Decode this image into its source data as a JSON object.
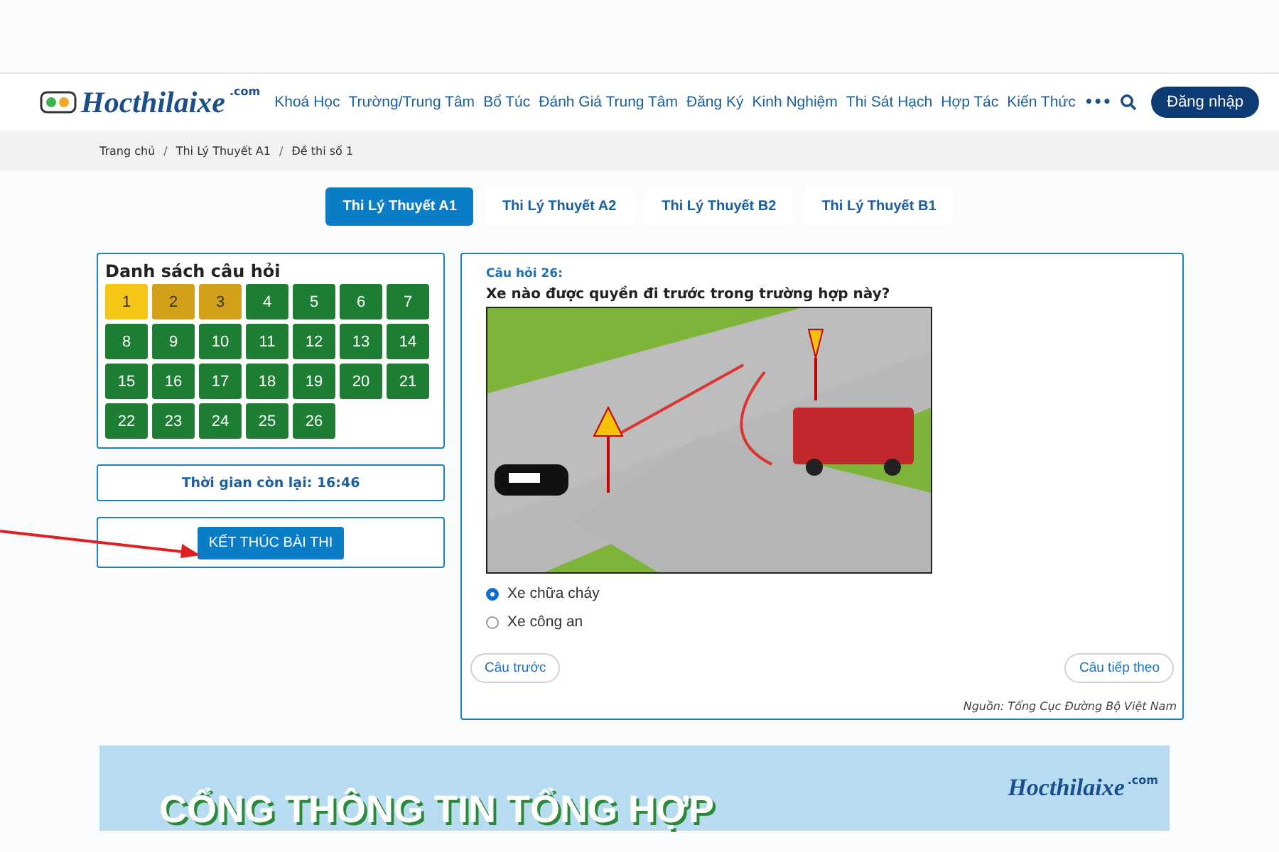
{
  "header": {
    "logo": {
      "name": "Hocthilaixe",
      "suffix": ".com"
    },
    "nav": [
      "Khoá Học",
      "Trường/Trung Tâm",
      "Bổ Túc",
      "Đánh Giá Trung Tâm",
      "Đăng Ký",
      "Kinh Nghiệm",
      "Thi Sát Hạch",
      "Hợp Tác",
      "Kiến Thức"
    ],
    "more": "•••",
    "login": "Đăng nhập"
  },
  "breadcrumb": {
    "separator": "/",
    "items": [
      "Trang chủ",
      "Thi Lý Thuyết A1",
      "Đề thi số 1"
    ]
  },
  "tabs": [
    {
      "label": "Thi Lý Thuyết A1",
      "selected": true
    },
    {
      "label": "Thi Lý Thuyết A2",
      "selected": false
    },
    {
      "label": "Thi Lý Thuyết B2",
      "selected": false
    },
    {
      "label": "Thi Lý Thuyết B1",
      "selected": false
    }
  ],
  "question_list": {
    "title": "Danh sách câu hỏi",
    "items": [
      {
        "label": "1",
        "color": "#f5c518"
      },
      {
        "label": "2",
        "color": "#d4a017"
      },
      {
        "label": "3",
        "color": "#d4a017"
      },
      {
        "label": "4",
        "color": "#1e7e34"
      },
      {
        "label": "5",
        "color": "#1e7e34"
      },
      {
        "label": "6",
        "color": "#1e7e34"
      },
      {
        "label": "7",
        "color": "#1e7e34"
      },
      {
        "label": "8",
        "color": "#1e7e34"
      },
      {
        "label": "9",
        "color": "#1e7e34"
      },
      {
        "label": "10",
        "color": "#1e7e34"
      },
      {
        "label": "11",
        "color": "#1e7e34"
      },
      {
        "label": "12",
        "color": "#1e7e34"
      },
      {
        "label": "13",
        "color": "#1e7e34"
      },
      {
        "label": "14",
        "color": "#1e7e34"
      },
      {
        "label": "15",
        "color": "#1e7e34"
      },
      {
        "label": "16",
        "color": "#1e7e34"
      },
      {
        "label": "17",
        "color": "#1e7e34"
      },
      {
        "label": "18",
        "color": "#1e7e34"
      },
      {
        "label": "19",
        "color": "#1e7e34"
      },
      {
        "label": "20",
        "color": "#1e7e34"
      },
      {
        "label": "21",
        "color": "#1e7e34"
      },
      {
        "label": "22",
        "color": "#1e7e34"
      },
      {
        "label": "23",
        "color": "#1e7e34"
      },
      {
        "label": "24",
        "color": "#1e7e34"
      },
      {
        "label": "25",
        "color": "#1e7e34"
      },
      {
        "label": "26",
        "color": "#1e7e34"
      }
    ]
  },
  "timer": "Thời gian còn lại: 16:46",
  "finish_button": "KẾT THÚC BÀI THI",
  "question": {
    "number": "Câu hỏi 26:",
    "text": "Xe nào được quyền đi trước trong trường hợp này?",
    "answers": [
      {
        "label": "Xe chữa cháy",
        "selected": true
      },
      {
        "label": "Xe công an",
        "selected": false
      }
    ],
    "prev": "Câu trước",
    "next": "Câu tiếp theo",
    "source": "Nguồn: Tổng Cục Đường Bộ Việt Nam"
  },
  "banner": {
    "headline": "CỔNG THÔNG TIN TỔNG HỢP",
    "logo": "Hocthilaixe",
    "logo_suffix": ".com"
  }
}
